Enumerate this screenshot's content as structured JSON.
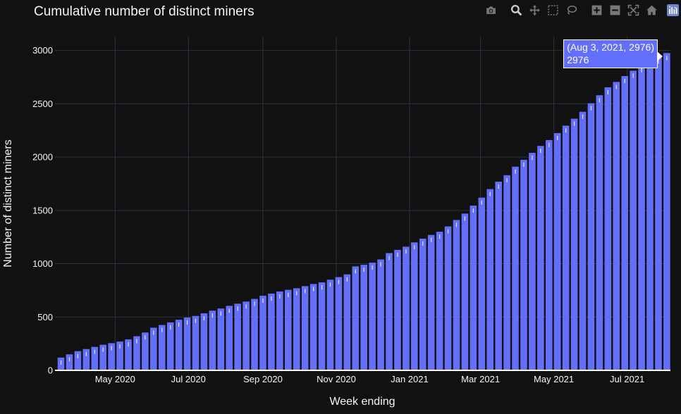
{
  "chart_data": {
    "type": "bar",
    "title": "Cumulative number of distinct miners",
    "xlabel": "Week ending",
    "ylabel": "Number of distinct miners",
    "ylim": [
      0,
      3130
    ],
    "xlim": [
      "2020-03-12",
      "2021-08-06"
    ],
    "yticks": [
      0,
      500,
      1000,
      1500,
      2000,
      2500,
      3000
    ],
    "xticks": [
      {
        "date": "2020-05-01",
        "label": "May 2020"
      },
      {
        "date": "2020-07-01",
        "label": "Jul 2020"
      },
      {
        "date": "2020-09-01",
        "label": "Sep 2020"
      },
      {
        "date": "2020-11-01",
        "label": "Nov 2020"
      },
      {
        "date": "2021-01-01",
        "label": "Jan 2021"
      },
      {
        "date": "2021-03-01",
        "label": "Mar 2021"
      },
      {
        "date": "2021-05-01",
        "label": "May 2021"
      },
      {
        "date": "2021-07-01",
        "label": "Jul 2021"
      }
    ],
    "grid": true,
    "bar_color": "#636efa",
    "x": [
      "2020-03-17",
      "2020-03-24",
      "2020-03-31",
      "2020-04-07",
      "2020-04-14",
      "2020-04-21",
      "2020-04-28",
      "2020-05-05",
      "2020-05-12",
      "2020-05-19",
      "2020-05-26",
      "2020-06-02",
      "2020-06-09",
      "2020-06-16",
      "2020-06-23",
      "2020-06-30",
      "2020-07-07",
      "2020-07-14",
      "2020-07-21",
      "2020-07-28",
      "2020-08-04",
      "2020-08-11",
      "2020-08-18",
      "2020-08-25",
      "2020-09-01",
      "2020-09-08",
      "2020-09-15",
      "2020-09-22",
      "2020-09-29",
      "2020-10-06",
      "2020-10-13",
      "2020-10-20",
      "2020-10-27",
      "2020-11-03",
      "2020-11-10",
      "2020-11-17",
      "2020-11-24",
      "2020-12-01",
      "2020-12-08",
      "2020-12-15",
      "2020-12-22",
      "2020-12-29",
      "2021-01-05",
      "2021-01-12",
      "2021-01-19",
      "2021-01-26",
      "2021-02-02",
      "2021-02-09",
      "2021-02-16",
      "2021-02-23",
      "2021-03-02",
      "2021-03-09",
      "2021-03-16",
      "2021-03-23",
      "2021-03-30",
      "2021-04-06",
      "2021-04-13",
      "2021-04-20",
      "2021-04-27",
      "2021-05-04",
      "2021-05-11",
      "2021-05-18",
      "2021-05-25",
      "2021-06-01",
      "2021-06-08",
      "2021-06-15",
      "2021-06-22",
      "2021-06-29",
      "2021-07-06",
      "2021-07-13",
      "2021-07-20",
      "2021-07-27",
      "2021-08-03"
    ],
    "values": [
      120,
      150,
      180,
      200,
      220,
      240,
      255,
      270,
      290,
      320,
      355,
      400,
      425,
      450,
      475,
      495,
      510,
      535,
      560,
      580,
      605,
      625,
      645,
      670,
      700,
      720,
      740,
      755,
      770,
      790,
      810,
      825,
      850,
      875,
      900,
      975,
      990,
      1010,
      1040,
      1100,
      1130,
      1160,
      1200,
      1235,
      1270,
      1300,
      1350,
      1410,
      1470,
      1545,
      1620,
      1700,
      1770,
      1830,
      1910,
      1975,
      2040,
      2105,
      2160,
      2225,
      2295,
      2360,
      2425,
      2505,
      2580,
      2655,
      2705,
      2760,
      2810,
      2860,
      2900,
      2940,
      2976
    ]
  },
  "tooltip": {
    "line1": "(Aug 3, 2021, 2976)",
    "line2": "2976"
  },
  "modebar": {
    "buttons": [
      {
        "icon": "camera-icon",
        "name": "download-plot-button"
      },
      {
        "icon": "zoom-icon",
        "name": "zoom-button"
      },
      {
        "icon": "pan-icon",
        "name": "pan-button"
      },
      {
        "icon": "box-select-icon",
        "name": "box-select-button"
      },
      {
        "icon": "lasso-select-icon",
        "name": "lasso-select-button"
      },
      {
        "icon": "zoom-in-icon",
        "name": "zoom-in-button"
      },
      {
        "icon": "zoom-out-icon",
        "name": "zoom-out-button"
      },
      {
        "icon": "autoscale-icon",
        "name": "autoscale-button"
      },
      {
        "icon": "reset-axes-icon",
        "name": "reset-axes-button"
      },
      {
        "icon": "plotly-logo-icon",
        "name": "plotly-logo"
      }
    ]
  }
}
